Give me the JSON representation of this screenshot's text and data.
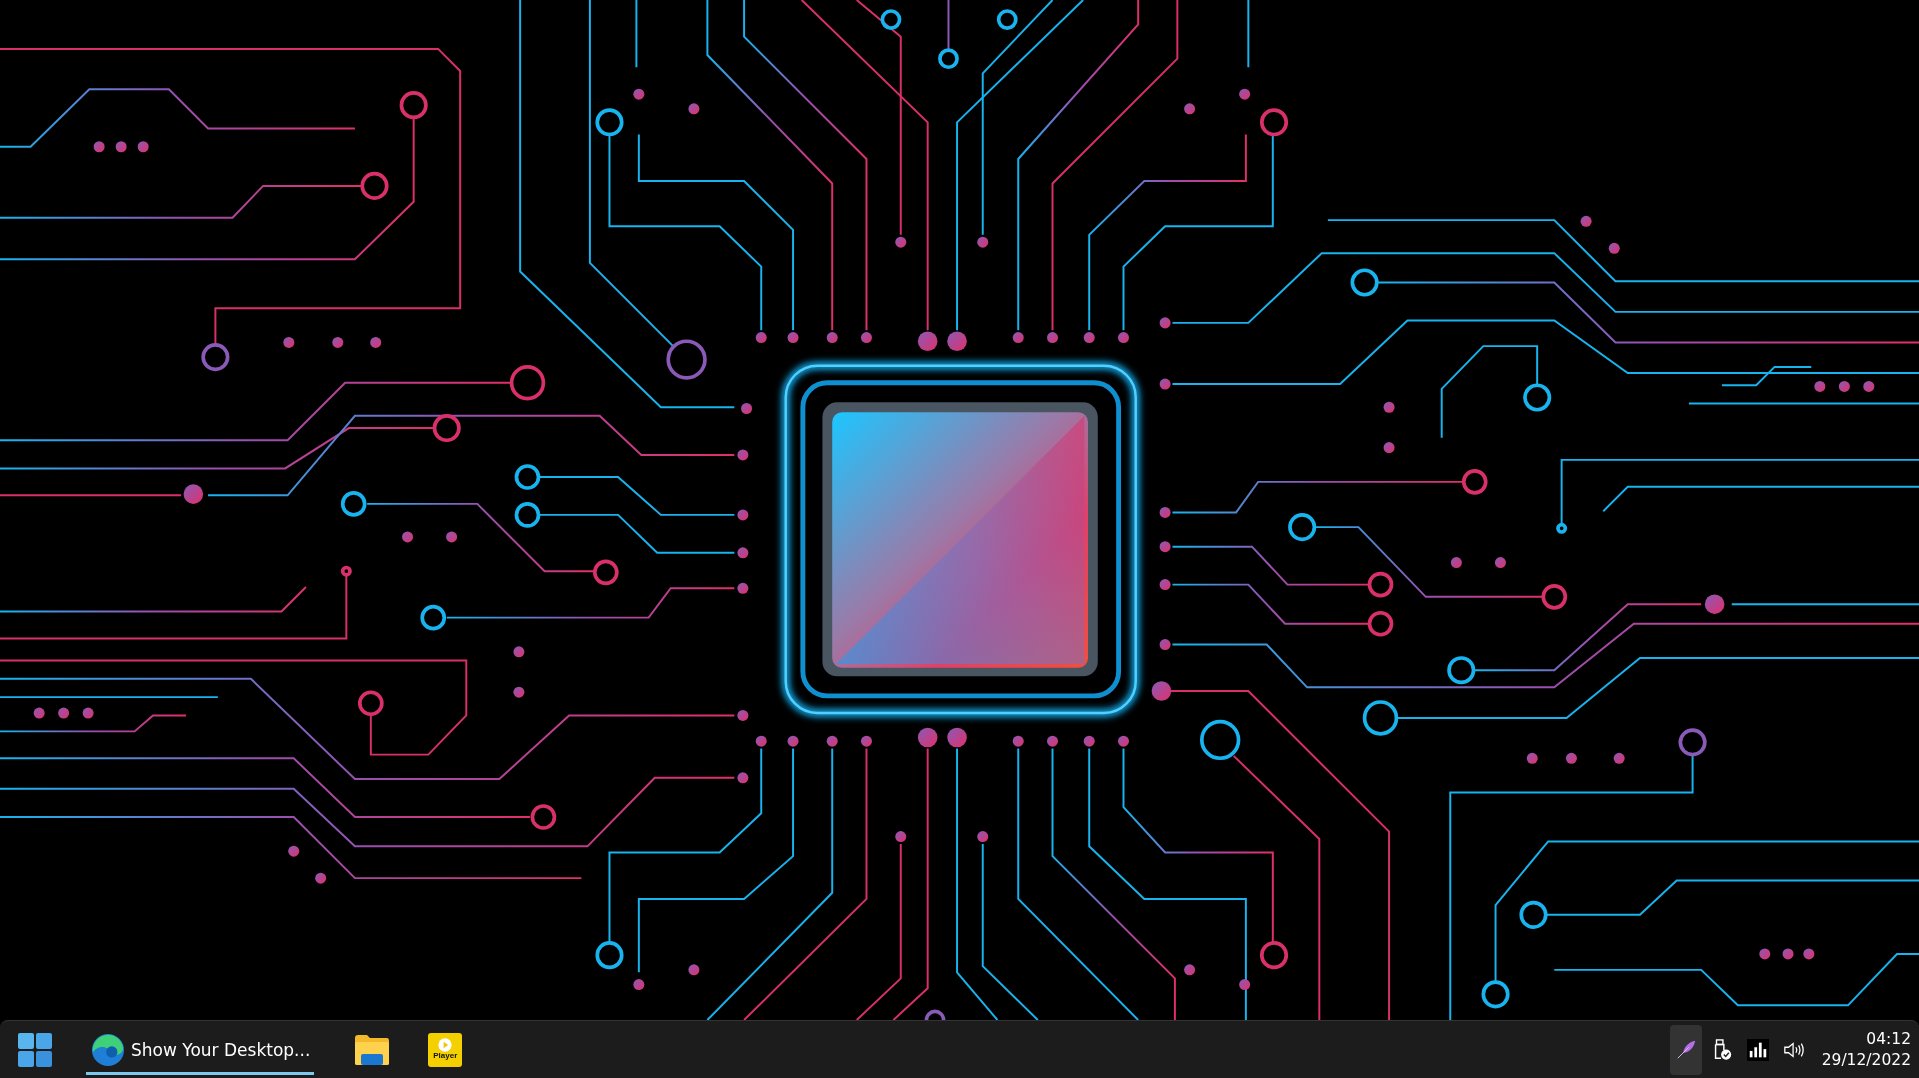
{
  "taskbar": {
    "apps": [
      {
        "kind": "edge",
        "label": "Show Your Desktop...",
        "running": true
      },
      {
        "kind": "explorer",
        "running": false
      },
      {
        "kind": "player",
        "label": "Player",
        "running": false
      }
    ],
    "tray": [
      {
        "kind": "pen",
        "selected": true
      },
      {
        "kind": "usb",
        "selected": false
      },
      {
        "kind": "network",
        "selected": false
      },
      {
        "kind": "volume",
        "selected": false
      }
    ],
    "clock": {
      "time": "04:12",
      "date": "29/12/2022"
    }
  }
}
